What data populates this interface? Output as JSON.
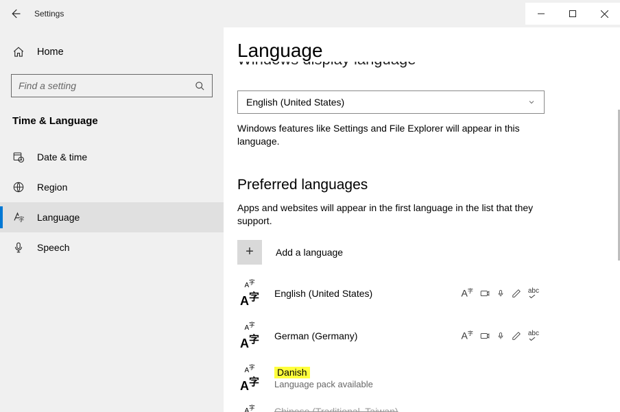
{
  "app": {
    "title": "Settings"
  },
  "sidebar": {
    "home": "Home",
    "search_placeholder": "Find a setting",
    "category": "Time & Language",
    "items": [
      {
        "label": "Date & time"
      },
      {
        "label": "Region"
      },
      {
        "label": "Language"
      },
      {
        "label": "Speech"
      }
    ]
  },
  "page": {
    "title": "Language",
    "section_cut": "Windows display language",
    "display_dropdown": "English (United States)",
    "display_desc": "Windows features like Settings and File Explorer will appear in this language.",
    "preferred_heading": "Preferred languages",
    "preferred_desc": "Apps and websites will appear in the first language in the list that they support.",
    "add_label": "Add a language",
    "languages": [
      {
        "name": "English (United States)",
        "sub": "",
        "icons": true,
        "highlight": false
      },
      {
        "name": "German (Germany)",
        "sub": "",
        "icons": true,
        "highlight": false
      },
      {
        "name": "Danish",
        "sub": "Language pack available",
        "icons": false,
        "highlight": true
      },
      {
        "name": "Chinese (Traditional, Taiwan)",
        "sub": "",
        "icons": false,
        "highlight": false,
        "cut": true
      }
    ]
  }
}
